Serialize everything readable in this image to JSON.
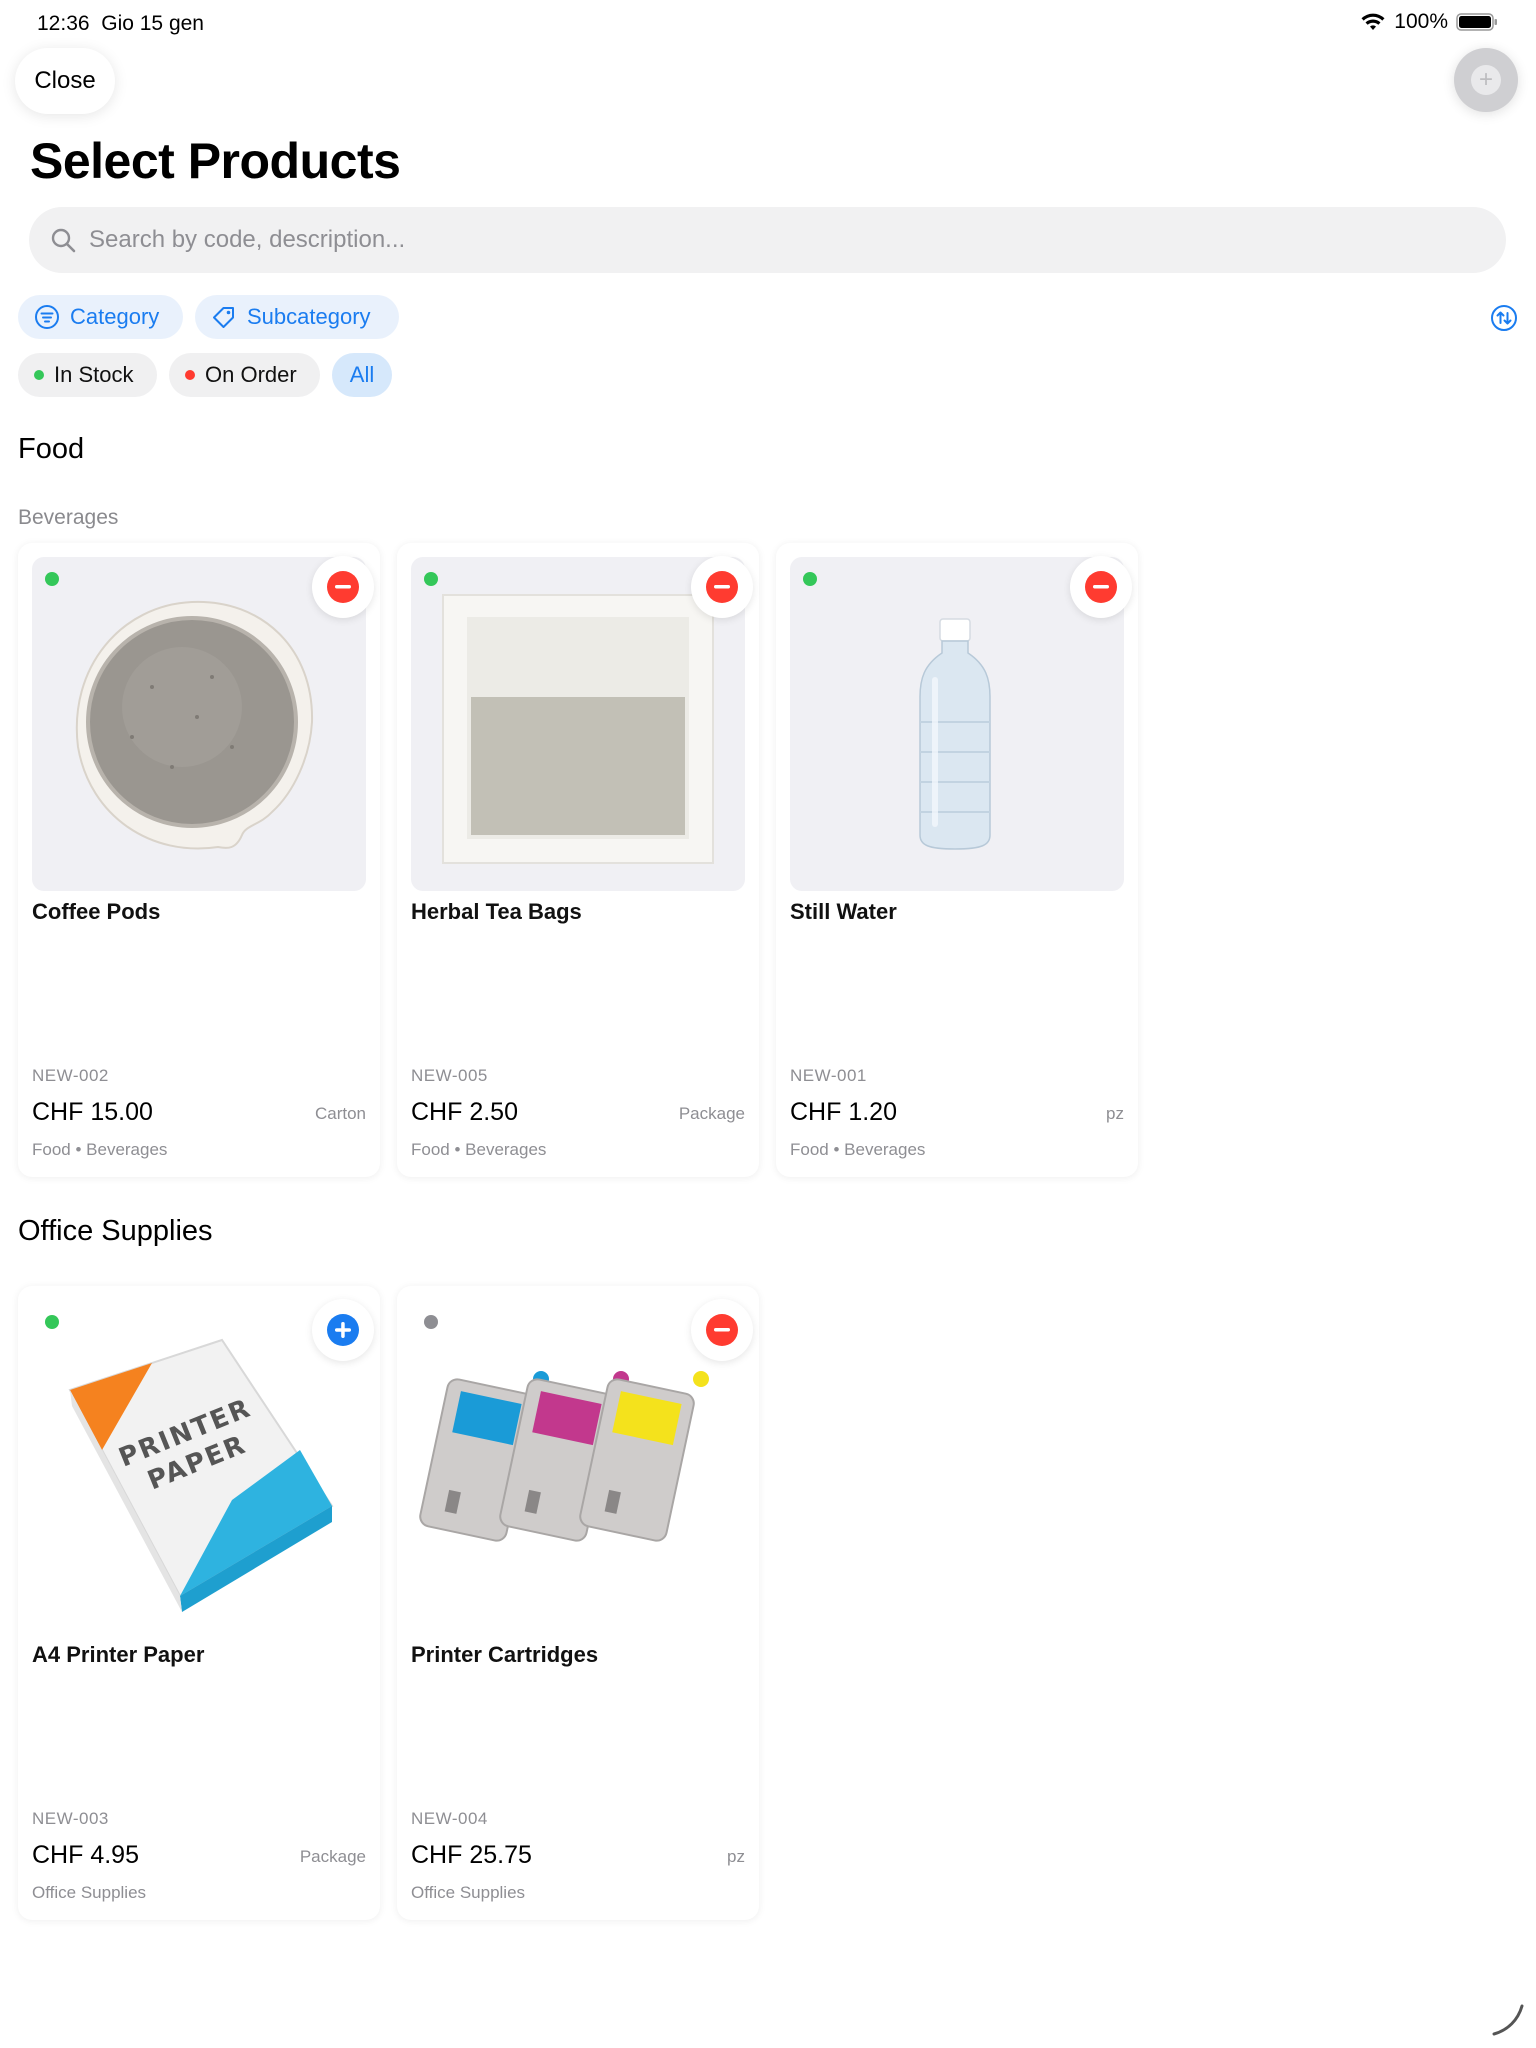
{
  "status_bar": {
    "time": "12:36",
    "date": "Gio 15 gen",
    "battery": "100%"
  },
  "header": {
    "close_label": "Close",
    "title": "Select Products"
  },
  "search": {
    "placeholder": "Search by code, description..."
  },
  "filters": {
    "category": "Category",
    "subcategory": "Subcategory",
    "in_stock": "In Stock",
    "on_order": "On Order",
    "all": "All",
    "selected": "All"
  },
  "colors": {
    "accent": "#1a7cf0",
    "in_stock": "#34c759",
    "on_order": "#ff3b30",
    "unavailable": "#8e8e93",
    "remove": "#ff3b30",
    "add": "#1a7cf0"
  },
  "sections": [
    {
      "title": "Food",
      "subtitle": "Beverages",
      "products": [
        {
          "name": "Coffee Pods",
          "code": "NEW-002",
          "price": "CHF 15.00",
          "unit": "Carton",
          "category": "Food • Beverages",
          "status": "in-stock",
          "action": "remove",
          "image": "coffee-pod-image"
        },
        {
          "name": "Herbal Tea Bags",
          "code": "NEW-005",
          "price": "CHF 2.50",
          "unit": "Package",
          "category": "Food • Beverages",
          "status": "in-stock",
          "action": "remove",
          "image": "tea-bag-image"
        },
        {
          "name": "Still Water",
          "code": "NEW-001",
          "price": "CHF 1.20",
          "unit": "pz",
          "category": "Food • Beverages",
          "status": "in-stock",
          "action": "remove",
          "image": "water-bottle-image"
        }
      ]
    },
    {
      "title": "Office Supplies",
      "products": [
        {
          "name": "A4 Printer Paper",
          "code": "NEW-003",
          "price": "CHF 4.95",
          "unit": "Package",
          "category": "Office Supplies",
          "status": "in-stock",
          "action": "add",
          "image": "printer-paper-image",
          "image_text": "PRINTER PAPER"
        },
        {
          "name": "Printer Cartridges",
          "code": "NEW-004",
          "price": "CHF 25.75",
          "unit": "pz",
          "category": "Office Supplies",
          "status": "unavailable",
          "action": "remove",
          "image": "printer-cartridges-image"
        }
      ]
    }
  ]
}
